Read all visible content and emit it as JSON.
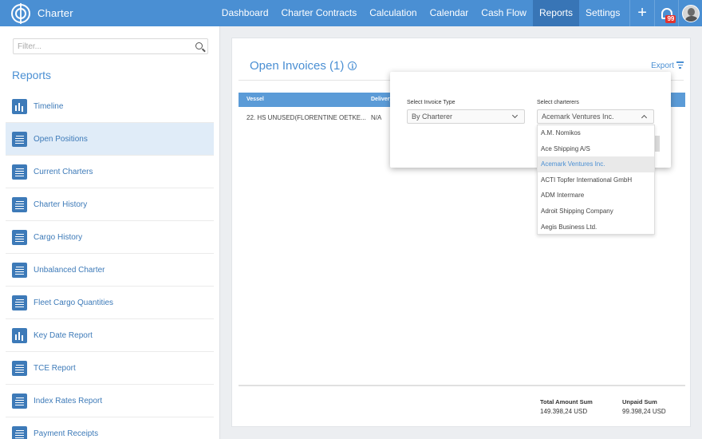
{
  "app": {
    "name": "Charter"
  },
  "nav": {
    "items": [
      {
        "label": "Dashboard",
        "active": false
      },
      {
        "label": "Charter Contracts",
        "active": false
      },
      {
        "label": "Calculation",
        "active": false
      },
      {
        "label": "Calendar",
        "active": false
      },
      {
        "label": "Cash Flow",
        "active": false
      },
      {
        "label": "Reports",
        "active": true
      },
      {
        "label": "Settings",
        "active": false
      }
    ],
    "plus": "+",
    "notification_count": "99"
  },
  "sidebar": {
    "filter_placeholder": "Filter...",
    "title": "Reports",
    "items": [
      {
        "label": "Timeline",
        "icon": "bar-chart-icon",
        "active": false
      },
      {
        "label": "Open Positions",
        "icon": "list-icon",
        "active": true
      },
      {
        "label": "Current Charters",
        "icon": "list-icon",
        "active": false
      },
      {
        "label": "Charter History",
        "icon": "list-icon",
        "active": false
      },
      {
        "label": "Cargo History",
        "icon": "list-icon",
        "active": false
      },
      {
        "label": "Unbalanced Charter",
        "icon": "list-icon",
        "active": false
      },
      {
        "label": "Fleet Cargo Quantities",
        "icon": "list-icon",
        "active": false
      },
      {
        "label": "Key Date Report",
        "icon": "bar-chart-icon",
        "active": false
      },
      {
        "label": "TCE Report",
        "icon": "list-icon",
        "active": false
      },
      {
        "label": "Index Rates Report",
        "icon": "list-icon",
        "active": false
      },
      {
        "label": "Payment Receipts",
        "icon": "list-icon",
        "active": false
      }
    ]
  },
  "main": {
    "title": "Open Invoices (1)",
    "info": "i",
    "export_label": "Export",
    "table": {
      "columns": [
        "Vessel",
        "Delivery"
      ],
      "rows": [
        {
          "vessel": "22. HS UNUSED(FLORENTINE OETKE...",
          "delivery": "N/A"
        }
      ]
    },
    "summary": {
      "total_label": "Total Amount Sum",
      "total_value": "149.398,24 USD",
      "unpaid_label": "Unpaid Sum",
      "unpaid_value": "99.398,24 USD"
    }
  },
  "popup": {
    "invoice_type_label": "Select Invoice Type",
    "invoice_type_value": "By Charterer",
    "charterers_label": "Select charterers",
    "charterers_value": "Acemark Ventures Inc.",
    "options": [
      "A.M. Nomikos",
      "Ace Shipping A/S",
      "Acemark Ventures Inc.",
      "ACTI Topfer International GmbH",
      "ADM Intermare",
      "Adroit Shipping Company",
      "Aegis Business Ltd."
    ],
    "selected_index": 2
  },
  "colors": {
    "primary": "#4a8fd3",
    "nav_active": "#3875b6",
    "table_header": "#5b9bd7",
    "sidebar_active": "#e0ecf8",
    "badge": "#e2332e"
  }
}
